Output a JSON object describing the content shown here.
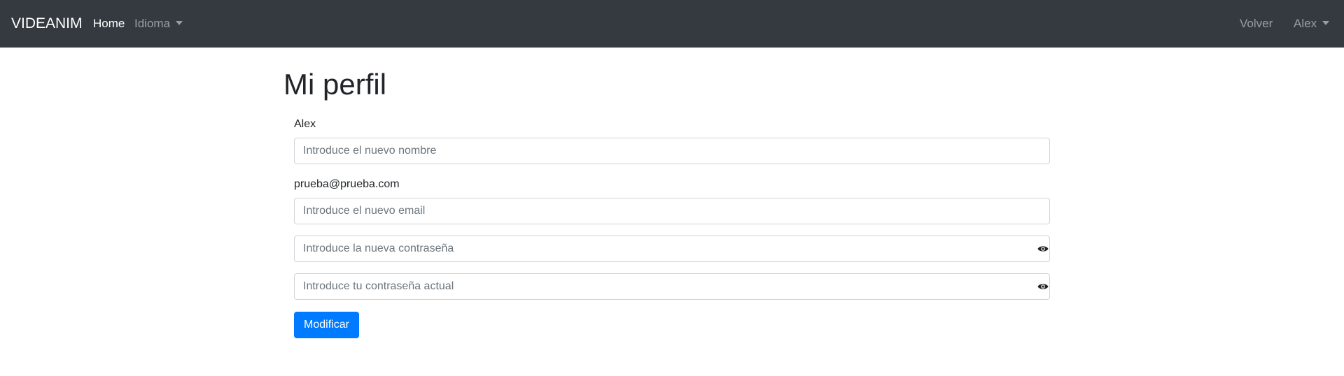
{
  "navbar": {
    "brand": "VIDEANIM",
    "home": "Home",
    "language": "Idioma",
    "back": "Volver",
    "user": "Alex"
  },
  "profile": {
    "title": "Mi perfil",
    "current_name": "Alex",
    "name_placeholder": "Introduce el nuevo nombre",
    "current_email": "prueba@prueba.com",
    "email_placeholder": "Introduce el nuevo email",
    "new_password_placeholder": "Introduce la nueva contraseña",
    "current_password_placeholder": "Introduce tu contraseña actual",
    "submit_label": "Modificar"
  },
  "colors": {
    "navbar_bg": "#343a40",
    "primary": "#007bff"
  },
  "icons": {
    "password_toggle": "eye-icon",
    "dropdown": "caret-down-icon"
  }
}
